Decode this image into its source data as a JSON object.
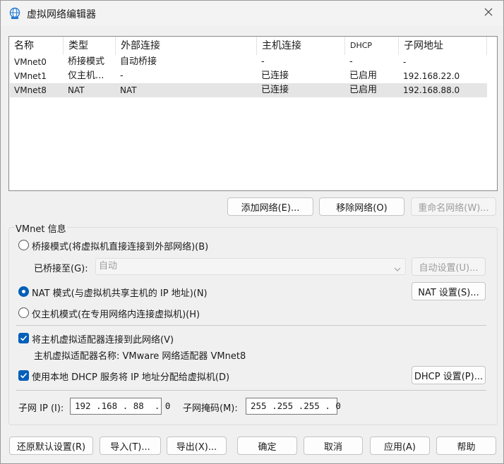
{
  "window": {
    "title": "虚拟网络编辑器",
    "icon": "network-globe-icon",
    "close_glyph": "✕"
  },
  "network_list": {
    "columns": [
      "名称",
      "类型",
      "外部连接",
      "主机连接",
      "DHCP",
      "子网地址"
    ],
    "rows": [
      {
        "name": "VMnet0",
        "type": "桥接模式",
        "external": "自动桥接",
        "host": "-",
        "dhcp": "-",
        "subnet": "-"
      },
      {
        "name": "VMnet1",
        "type": "仅主机...",
        "external": "-",
        "host": "已连接",
        "dhcp": "已启用",
        "subnet": "192.168.22.0"
      },
      {
        "name": "VMnet8",
        "type": "NAT",
        "external": "NAT",
        "host": "已连接",
        "dhcp": "已启用",
        "subnet": "192.168.88.0"
      }
    ],
    "selected_row": "VMnet8"
  },
  "list_buttons": {
    "add": "添加网络(E)...",
    "remove": "移除网络(O)",
    "rename": "重命名网络(W)..."
  },
  "vmnet_info": {
    "group_title": "VMnet 信息",
    "bridged_label": "桥接模式(将虚拟机直接连接到外部网络)(B)",
    "bridged_to_label": "已桥接至(G):",
    "bridged_to_value": "自动",
    "auto_settings_button": "自动设置(U)...",
    "nat_label": "NAT 模式(与虚拟机共享主机的 IP 地址)(N)",
    "nat_settings_button": "NAT 设置(S)...",
    "hostonly_label": "仅主机模式(在专用网络内连接虚拟机)(H)",
    "selected_mode": "NAT",
    "connect_adapter_label": "将主机虚拟适配器连接到此网络(V)",
    "connect_adapter_checked": true,
    "adapter_name_text": "主机虚拟适配器名称: VMware 网络适配器 VMnet8",
    "dhcp_label": "使用本地 DHCP 服务将 IP 地址分配给虚拟机(D)",
    "dhcp_checked": true,
    "dhcp_settings_button": "DHCP 设置(P)...",
    "subnet_ip_label": "子网 IP (I):",
    "subnet_ip_value": "192 .168 . 88  . 0",
    "subnet_mask_label": "子网掩码(M):",
    "subnet_mask_value": "255 .255 .255 . 0"
  },
  "footer": {
    "restore_defaults": "还原默认设置(R)",
    "import": "导入(T)...",
    "export": "导出(X)...",
    "ok": "确定",
    "cancel": "取消",
    "apply": "应用(A)",
    "help": "帮助"
  },
  "colors": {
    "accent": "#005fb8",
    "selected_row": "#e5e5e5",
    "disabled_text": "#9d9d9d"
  }
}
